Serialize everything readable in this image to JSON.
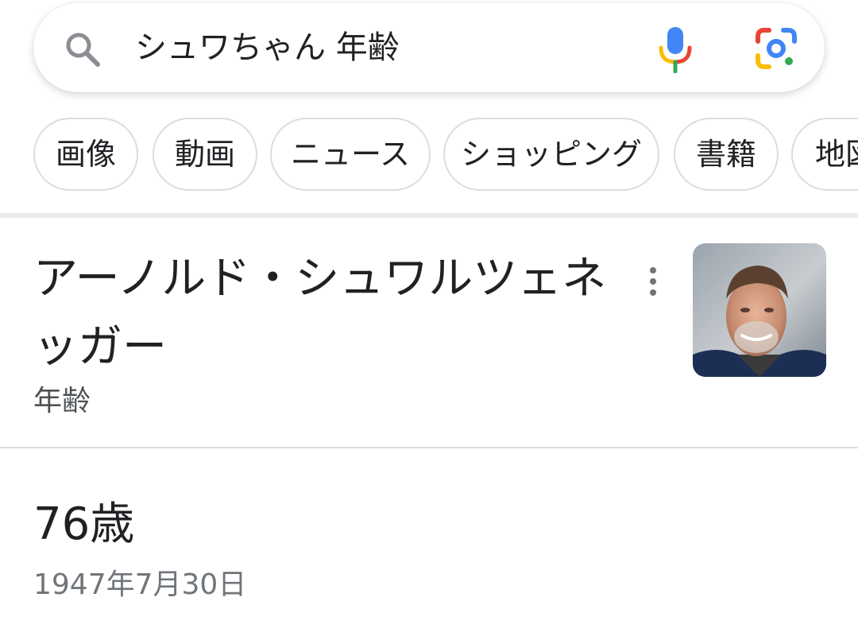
{
  "search": {
    "query": "シュワちゃん 年齢"
  },
  "chips": [
    {
      "label": "画像"
    },
    {
      "label": "動画"
    },
    {
      "label": "ニュース"
    },
    {
      "label": "ショッピング"
    },
    {
      "label": "書籍"
    },
    {
      "label": "地図"
    }
  ],
  "entity": {
    "title": "アーノルド・シュワルツェネッガー",
    "subtitle": "年齢"
  },
  "answer": {
    "value": "76歳",
    "birth_date": "1947年7月30日"
  },
  "icons": {
    "search": "search-icon",
    "voice": "microphone-icon",
    "lens": "camera-lens-icon",
    "more": "more-vert-icon"
  },
  "colors": {
    "google_blue": "#4285F4",
    "google_red": "#EA4335",
    "google_yellow": "#FBBC05",
    "google_green": "#34A853"
  }
}
